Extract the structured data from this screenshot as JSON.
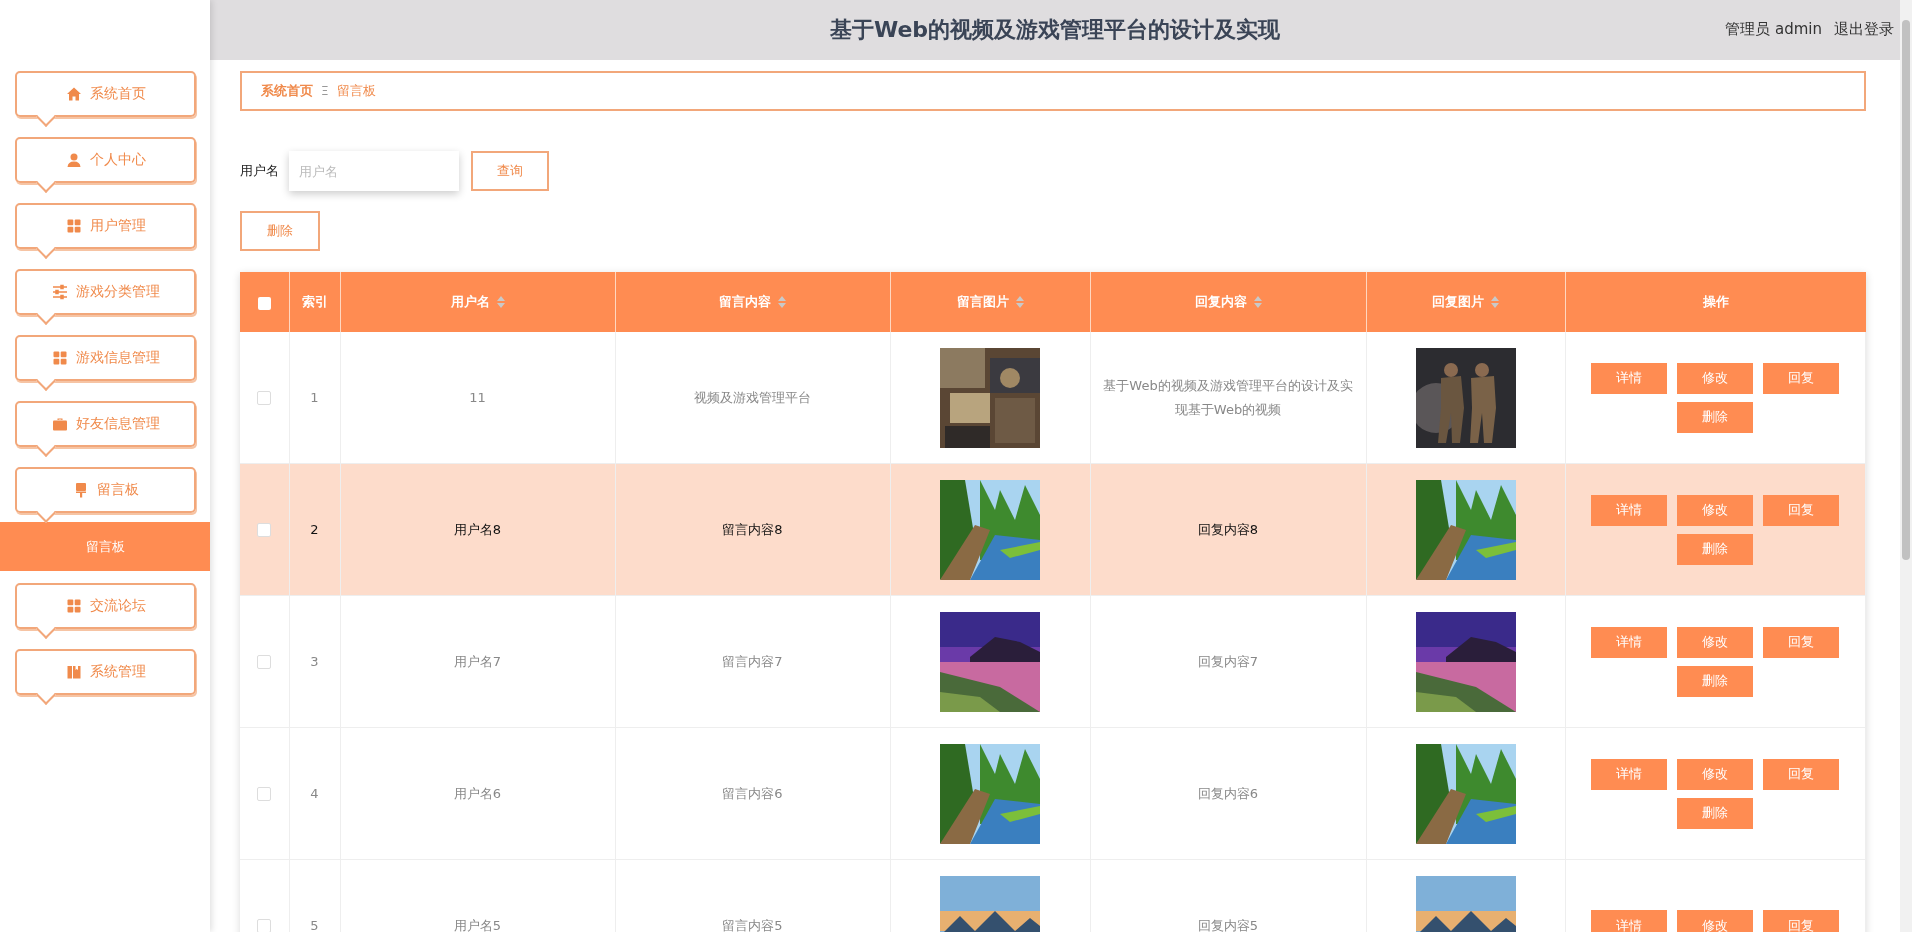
{
  "header": {
    "title": "基于Web的视频及游戏管理平台的设计及实现",
    "user": "管理员 admin",
    "logout": "退出登录"
  },
  "sidebar": {
    "items": [
      {
        "label": "系统首页"
      },
      {
        "label": "个人中心"
      },
      {
        "label": "用户管理"
      },
      {
        "label": "游戏分类管理"
      },
      {
        "label": "游戏信息管理"
      },
      {
        "label": "好友信息管理"
      },
      {
        "label": "留言板",
        "children": [
          {
            "label": "留言板",
            "selected": true
          }
        ]
      },
      {
        "label": "交流论坛"
      },
      {
        "label": "系统管理"
      }
    ]
  },
  "breadcrumb": {
    "home": "系统首页",
    "separator": "Ξ",
    "current": "留言板"
  },
  "search": {
    "label": "用户名",
    "placeholder": "用户名",
    "button": "查询"
  },
  "delete_button": "删除",
  "table": {
    "all_checked": false,
    "columns": [
      {
        "label": "索引",
        "sortable": false
      },
      {
        "label": "用户名",
        "sortable": true
      },
      {
        "label": "留言内容",
        "sortable": true
      },
      {
        "label": "留言图片",
        "sortable": true
      },
      {
        "label": "回复内容",
        "sortable": true
      },
      {
        "label": "回复图片",
        "sortable": true
      },
      {
        "label": "操作",
        "sortable": false
      }
    ],
    "rows": [
      {
        "index": "1",
        "username": "11",
        "content": "视频及游戏管理平台",
        "reply": "基于Web的视频及游戏管理平台的设计及实现基于Web的视频",
        "checked": false,
        "highlighted": false,
        "actions": [
          "详情",
          "修改",
          "回复",
          "删除"
        ]
      },
      {
        "index": "2",
        "username": "用户名8",
        "content": "留言内容8",
        "reply": "回复内容8",
        "checked": false,
        "highlighted": true,
        "actions": [
          "详情",
          "修改",
          "回复",
          "删除"
        ]
      },
      {
        "index": "3",
        "username": "用户名7",
        "content": "留言内容7",
        "reply": "回复内容7",
        "checked": false,
        "highlighted": false,
        "actions": [
          "详情",
          "修改",
          "回复",
          "删除"
        ]
      },
      {
        "index": "4",
        "username": "用户名6",
        "content": "留言内容6",
        "reply": "回复内容6",
        "checked": false,
        "highlighted": false,
        "actions": [
          "详情",
          "修改",
          "回复",
          "删除"
        ]
      },
      {
        "index": "5",
        "username": "用户名5",
        "content": "留言内容5",
        "reply": "回复内容5",
        "checked": false,
        "highlighted": false,
        "actions": [
          "详情",
          "修改",
          "回复"
        ]
      }
    ]
  }
}
